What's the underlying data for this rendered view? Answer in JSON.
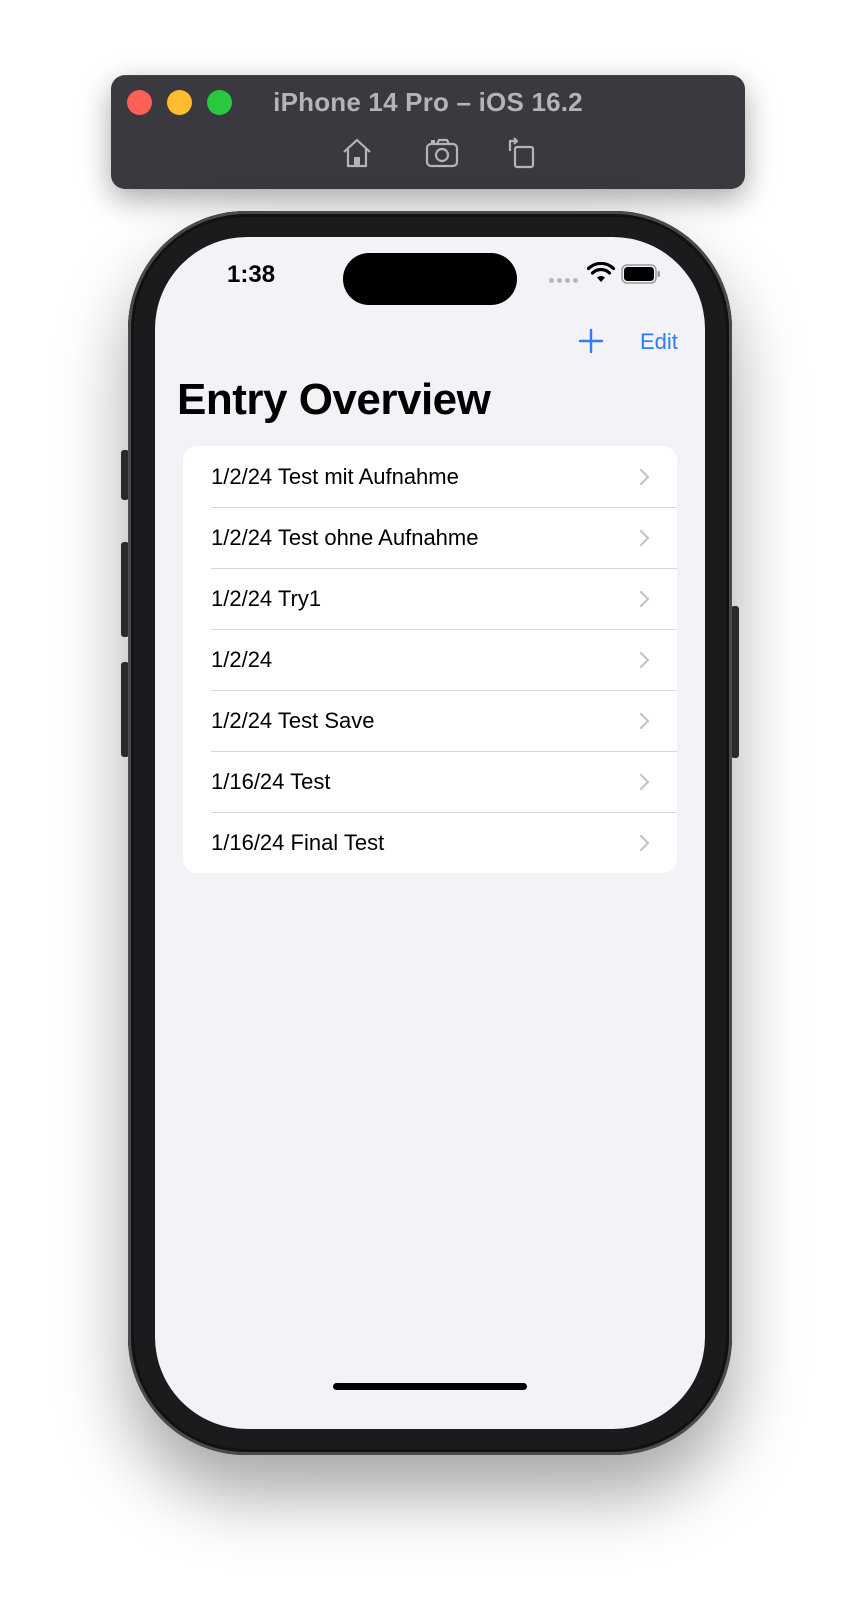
{
  "simulator": {
    "title": "iPhone 14 Pro – iOS 16.2",
    "tools": [
      "home-icon",
      "screenshot-icon",
      "rotate-icon"
    ]
  },
  "status_bar": {
    "time": "1:38"
  },
  "nav": {
    "add_icon": "plus-icon",
    "edit_label": "Edit",
    "title": "Entry Overview",
    "accent_color": "#2f7cf6"
  },
  "entries": [
    {
      "label": "1/2/24 Test mit Aufnahme"
    },
    {
      "label": "1/2/24 Test ohne Aufnahme"
    },
    {
      "label": "1/2/24 Try1"
    },
    {
      "label": "1/2/24"
    },
    {
      "label": "1/2/24 Test Save"
    },
    {
      "label": "1/16/24 Test"
    },
    {
      "label": "1/16/24 Final Test"
    }
  ]
}
